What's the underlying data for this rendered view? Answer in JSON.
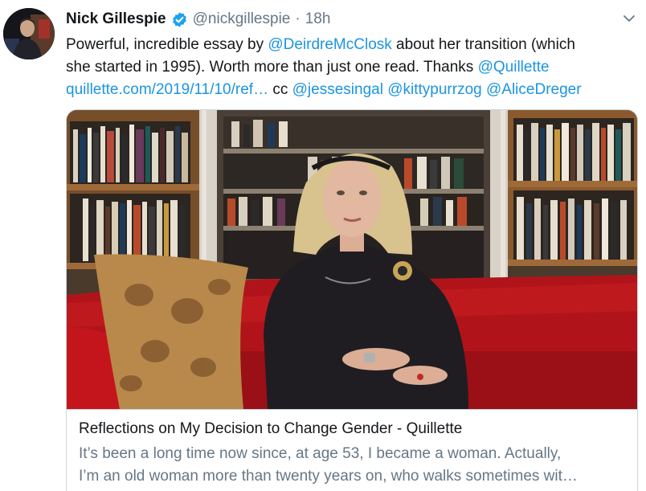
{
  "tweet": {
    "display_name": "Nick Gillespie",
    "handle": "@nickgillespie",
    "separator": "·",
    "time": "18h",
    "icons": {
      "verified": "verified-badge-icon",
      "caret": "chevron-down-icon"
    },
    "text": {
      "line1": {
        "t1": "Powerful, incredible essay by ",
        "m1": "@DeirdreMcClosk",
        "t2": " about her transition (which"
      },
      "line2": {
        "t1": "she started in 1995). Worth more than just one read. Thanks ",
        "m1": "@Quillette"
      },
      "line3": {
        "link": "quillette.com/2019/11/10/ref…",
        "t1": " cc ",
        "m1": "@jessesingal",
        "m2": "@kittypurrzog",
        "m3": "@AliceDreger"
      }
    }
  },
  "card": {
    "title": "Reflections on My Decision to Change Gender - Quillette",
    "description_line1": "It’s been a long time now since, at age 53, I became a woman. Actually,",
    "description_line2": "I’m an old woman more than twenty years on, who walks sometimes wit…"
  },
  "colors": {
    "link": "#1b95e0",
    "secondary": "#657786",
    "border": "#ccd6dd",
    "verified": "#1da1f2"
  }
}
